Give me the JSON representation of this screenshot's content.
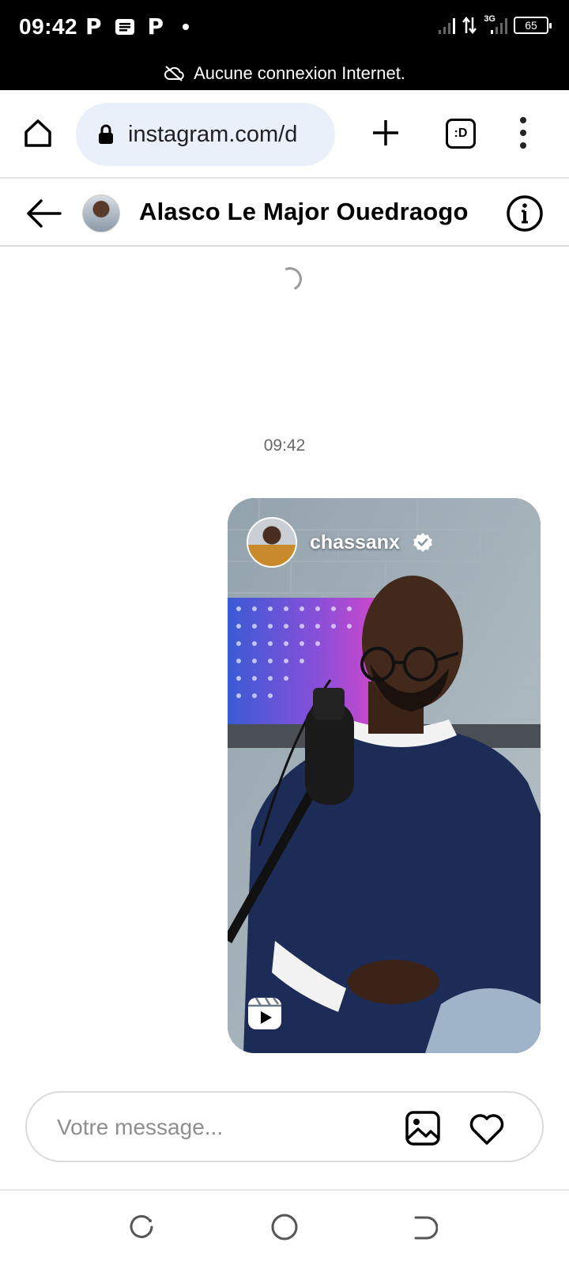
{
  "status_bar": {
    "time": "09:42",
    "notification_icons": [
      "P",
      "P"
    ],
    "network_label": "3G",
    "battery": "65"
  },
  "offline_banner": {
    "text": "Aucune connexion Internet."
  },
  "browser": {
    "url": "instagram.com/d",
    "tabs_label": ":D"
  },
  "chat_header": {
    "contact_name": "Alasco Le Major Ouedraogo"
  },
  "conversation": {
    "timestamp": "09:42",
    "shared_reel": {
      "username": "chassanx",
      "verified": true
    }
  },
  "composer": {
    "placeholder": "Votre message..."
  },
  "colors": {
    "url_bg": "#eaf0fa",
    "border": "#dbdbdb",
    "muted_text": "#65676b"
  }
}
